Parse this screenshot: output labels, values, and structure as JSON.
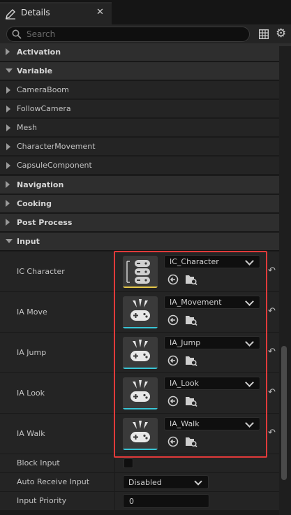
{
  "panel": {
    "tab_title": "Details",
    "tab_icon": "pencil-icon",
    "close_glyph": "✕"
  },
  "search": {
    "placeholder": "Search"
  },
  "categories_top": [
    {
      "label": "Activation",
      "expanded": false
    },
    {
      "label": "Variable",
      "expanded": true
    }
  ],
  "variable_items": [
    {
      "label": "CameraBoom"
    },
    {
      "label": "FollowCamera"
    },
    {
      "label": "Mesh"
    },
    {
      "label": "CharacterMovement"
    },
    {
      "label": "CapsuleComponent"
    }
  ],
  "categories_mid": [
    {
      "label": "Navigation",
      "expanded": false
    },
    {
      "label": "Cooking",
      "expanded": false
    },
    {
      "label": "Post Process",
      "expanded": false
    },
    {
      "label": "Input",
      "expanded": true
    }
  ],
  "input_assets": [
    {
      "label": "IC Character",
      "value": "IC_Character",
      "kind": "context",
      "accent": "#e6c84a"
    },
    {
      "label": "IA Move",
      "value": "IA_Movement",
      "kind": "action",
      "accent": "#39c6d6"
    },
    {
      "label": "IA Jump",
      "value": "IA_Jump",
      "kind": "action",
      "accent": "#39c6d6"
    },
    {
      "label": "IA Look",
      "value": "IA_Look",
      "kind": "action",
      "accent": "#39c6d6"
    },
    {
      "label": "IA Walk",
      "value": "IA_Walk",
      "kind": "action",
      "accent": "#39c6d6"
    }
  ],
  "input_props": {
    "block_input": {
      "label": "Block Input",
      "checked": false
    },
    "auto_receive": {
      "label": "Auto Receive Input",
      "value": "Disabled"
    },
    "priority": {
      "label": "Input Priority",
      "value": "0"
    }
  },
  "colors": {
    "highlight": "#e03a3a",
    "panel_bg": "#242424",
    "category_bg": "#2e2e2e"
  }
}
